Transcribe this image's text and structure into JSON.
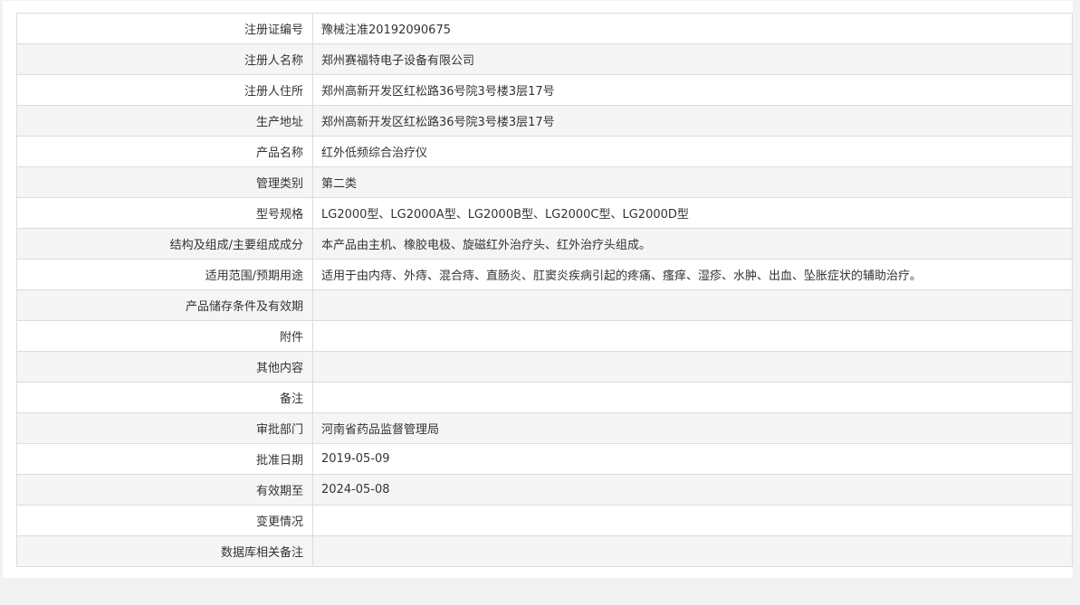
{
  "rows": [
    {
      "label": "注册证编号",
      "value": "豫械注准20192090675"
    },
    {
      "label": "注册人名称",
      "value": "郑州赛福特电子设备有限公司"
    },
    {
      "label": "注册人住所",
      "value": "郑州高新开发区红松路36号院3号楼3层17号"
    },
    {
      "label": "生产地址",
      "value": "郑州高新开发区红松路36号院3号楼3层17号"
    },
    {
      "label": "产品名称",
      "value": "红外低频综合治疗仪"
    },
    {
      "label": "管理类别",
      "value": "第二类"
    },
    {
      "label": "型号规格",
      "value": "LG2000型、LG2000A型、LG2000B型、LG2000C型、LG2000D型"
    },
    {
      "label": "结构及组成/主要组成成分",
      "value": "本产品由主机、橡胶电极、旋磁红外治疗头、红外治疗头组成。"
    },
    {
      "label": "适用范围/预期用途",
      "value": "适用于由内痔、外痔、混合痔、直肠炎、肛窦炎疾病引起的疼痛、瘙痒、湿疹、水肿、出血、坠胀症状的辅助治疗。"
    },
    {
      "label": "产品储存条件及有效期",
      "value": ""
    },
    {
      "label": "附件",
      "value": ""
    },
    {
      "label": "其他内容",
      "value": ""
    },
    {
      "label": "备注",
      "value": ""
    },
    {
      "label": "审批部门",
      "value": "河南省药品监督管理局"
    },
    {
      "label": "批准日期",
      "value": "2019-05-09"
    },
    {
      "label": "有效期至",
      "value": "2024-05-08"
    },
    {
      "label": "变更情况",
      "value": ""
    },
    {
      "label": "数据库相关备注",
      "value": ""
    }
  ]
}
